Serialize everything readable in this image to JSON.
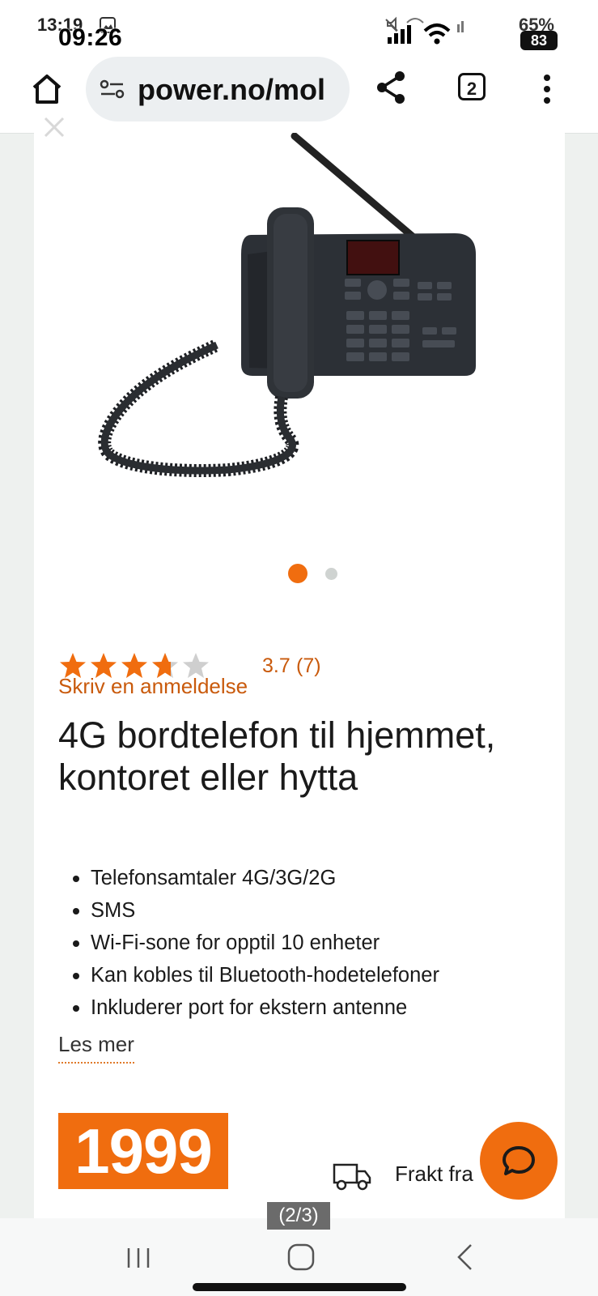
{
  "status_bar": {
    "time_under": "13:19",
    "time_over": "09:26",
    "battery_under": "65%",
    "battery_over": "83"
  },
  "browser": {
    "url": "power.no/mol",
    "tab_count": "2"
  },
  "gallery": {
    "image_counter": "(2/3)",
    "total_dots": 2,
    "active_dot": 1
  },
  "product": {
    "rating_value": "3.7",
    "rating_count": "(7)",
    "rating": 3.7,
    "rating_max": 5,
    "review_link": "Skriv en anmeldelse",
    "title": "4G bordtelefon til hjemmet, kontoret eller hytta",
    "features": [
      "Telefonsamtaler 4G/3G/2G",
      "SMS",
      "Wi-Fi-sone for opptil 10 enheter",
      "Kan kobles til Bluetooth-hodetelefoner",
      "Inkluderer port for ekstern antenne"
    ],
    "read_more": "Les mer",
    "price": "1999",
    "shipping_text": "Frakt fra"
  },
  "colors": {
    "brand_orange": "#f06d0f",
    "link_orange": "#c95a0c",
    "star_empty": "#cfcfcf"
  }
}
